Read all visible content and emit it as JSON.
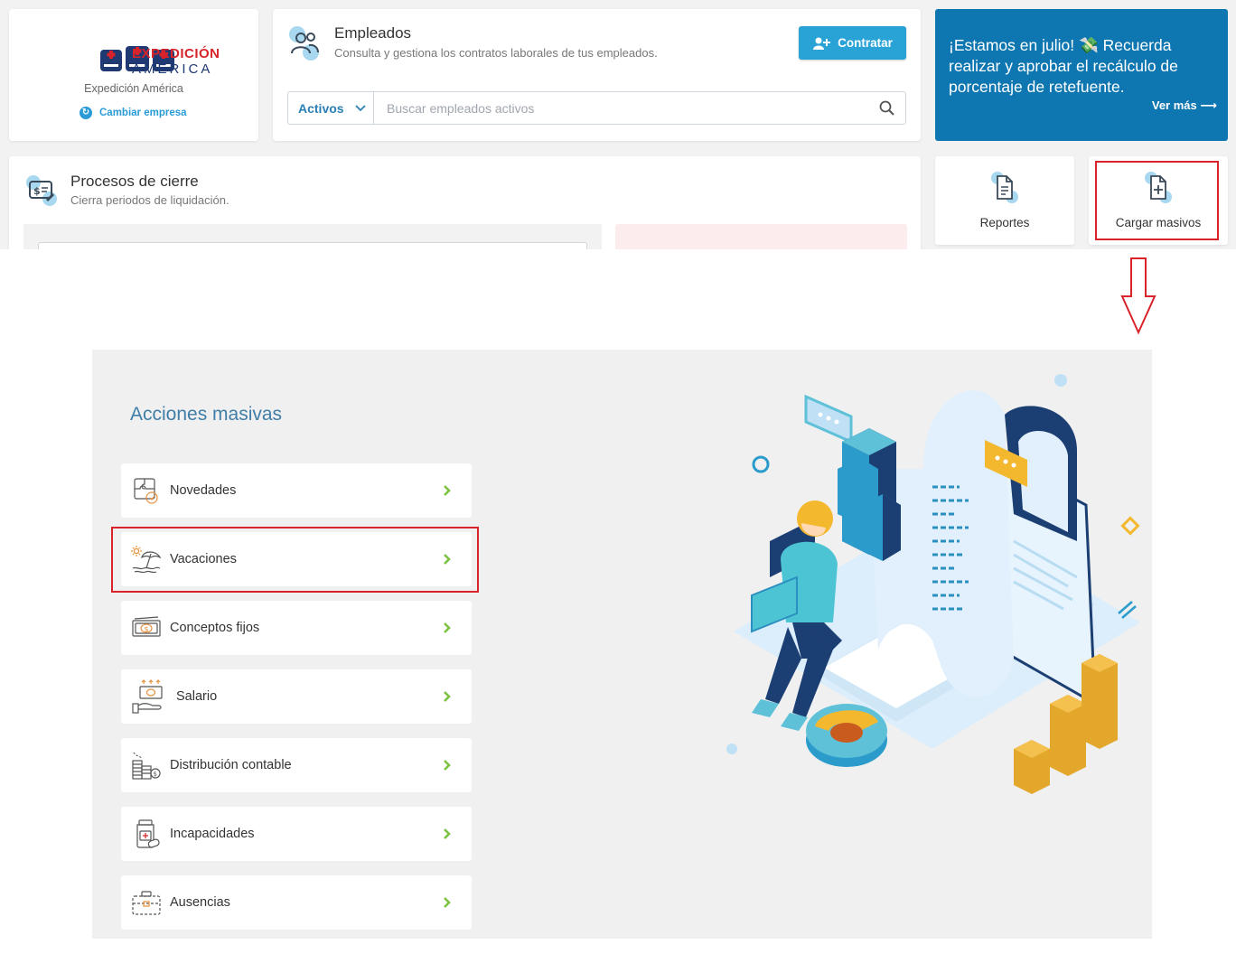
{
  "company": {
    "logo_line1": "EXPEDICIÓN",
    "logo_line2": "AMÉRICA",
    "name": "Expedición América",
    "change_label": "Cambiar empresa"
  },
  "employees": {
    "title": "Empleados",
    "subtitle": "Consulta y gestiona los contratos laborales de tus empleados.",
    "hire_label": "Contratar",
    "filter_value": "Activos",
    "search_placeholder": "Buscar empleados activos"
  },
  "promo": {
    "text": "¡Estamos en julio! 💸 Recuerda realizar y aprobar el recálculo de porcentaje de retefuente.",
    "link": "Ver más ⟶"
  },
  "closing": {
    "title": "Procesos de cierre",
    "subtitle": "Cierra periodos de liquidación."
  },
  "tiles": {
    "reports_label": "Reportes",
    "bulk_upload_label": "Cargar masivos"
  },
  "bulk_actions": {
    "title": "Acciones masivas",
    "items": [
      {
        "label": "Novedades",
        "icon": "puzzle-icon"
      },
      {
        "label": "Vacaciones",
        "icon": "beach-umbrella-icon"
      },
      {
        "label": "Conceptos fijos",
        "icon": "money-bill-icon"
      },
      {
        "label": "Salario",
        "icon": "salary-hand-icon"
      },
      {
        "label": "Distribución contable",
        "icon": "coins-stack-icon"
      },
      {
        "label": "Incapacidades",
        "icon": "medicine-icon"
      },
      {
        "label": "Ausencias",
        "icon": "briefcase-icon"
      }
    ]
  },
  "colors": {
    "accent": "#29a3d6",
    "promo_bg": "#0e76b0",
    "highlight": "#d8232a",
    "chevron": "#7cc242",
    "title_blue": "#3f7ea8"
  }
}
